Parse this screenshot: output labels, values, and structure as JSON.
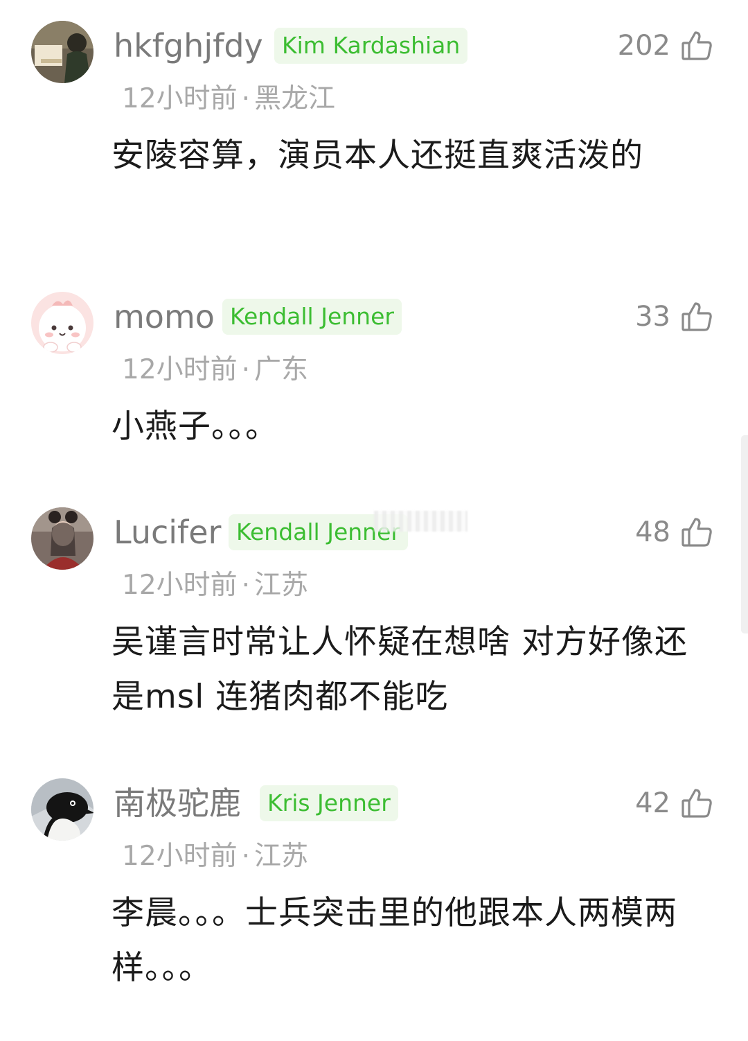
{
  "comments": [
    {
      "username": "hkfghjfdy",
      "badge": "Kim Kardashian",
      "likes": "202",
      "time": "12小时前",
      "separator": "·",
      "location": "黑龙江",
      "text": "安陵容算，演员本人还挺直爽活泼的"
    },
    {
      "username": "momo",
      "badge": "Kendall Jenner",
      "likes": "33",
      "time": "12小时前",
      "separator": "·",
      "location": "广东",
      "text": "小燕子。。。"
    },
    {
      "username": "Lucifer",
      "badge": "Kendall Jenner",
      "likes": "48",
      "time": "12小时前",
      "separator": "·",
      "location": "江苏",
      "text": "吴谨言时常让人怀疑在想啥 对方好像还是msl 连猪肉都不能吃"
    },
    {
      "username": "南极驼鹿",
      "badge": "Kris Jenner",
      "likes": "42",
      "time": "12小时前",
      "separator": "·",
      "location": "江苏",
      "text": "李晨。。。士兵突击里的他跟本人两模两样。。。"
    }
  ],
  "icons": {
    "like": "thumbs-up-icon"
  },
  "colors": {
    "badge_text": "#3cbd32",
    "badge_bg": "#eef8ea",
    "username": "#7a7a7a",
    "meta": "#a8a8a8",
    "body_text": "#1b1b1b"
  }
}
